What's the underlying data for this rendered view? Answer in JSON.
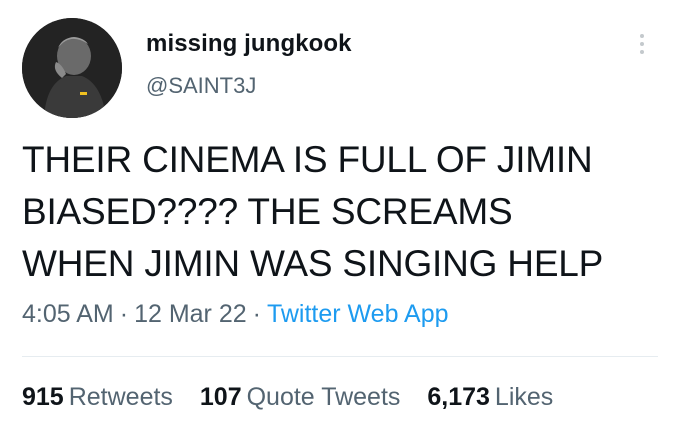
{
  "tweet": {
    "author": {
      "display_name": "missing jungkook",
      "handle": "@SAINT3J",
      "avatar_icon": "profile-photo"
    },
    "more_icon": "more-options-icon",
    "text_lines": [
      "THEIR CINEMA IS FULL OF JIMIN",
      "BIASED???? THE SCREAMS",
      "WHEN JIMIN WAS SINGING HELP"
    ],
    "time": "4:05 AM",
    "date": "12 Mar 22",
    "separator": "·",
    "source": "Twitter Web App",
    "stats": {
      "retweets": {
        "count": "915",
        "label": "Retweets"
      },
      "quote_tweets": {
        "count": "107",
        "label": "Quote Tweets"
      },
      "likes": {
        "count": "6,173",
        "label": "Likes"
      }
    }
  },
  "colors": {
    "text": "#0f1419",
    "secondary": "#536471",
    "link": "#1d9bf0",
    "divider": "#e6ecf0"
  }
}
